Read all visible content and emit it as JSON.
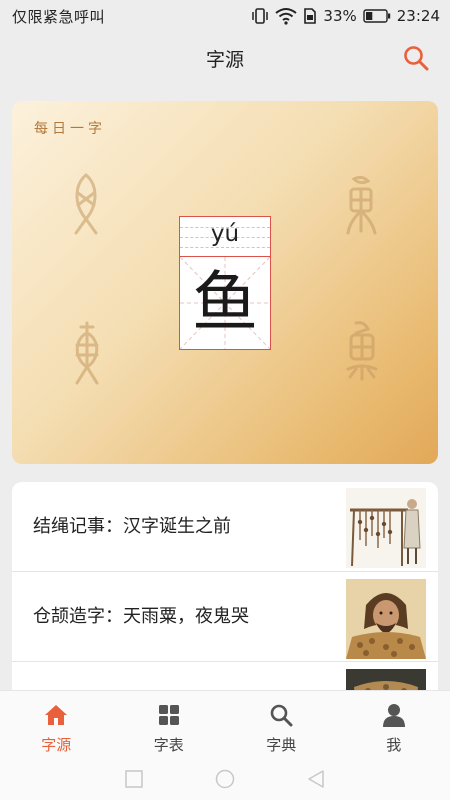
{
  "status_bar": {
    "carrier": "仅限紧急呼叫",
    "battery_percent": "33%",
    "time": "23:24",
    "battery_level": 0.33
  },
  "header": {
    "title": "字源",
    "search_icon": "search-icon"
  },
  "daily_character": {
    "label": "每日一字",
    "pinyin": "yú",
    "character": "鱼"
  },
  "articles": [
    {
      "title": "结绳记事：汉字诞生之前",
      "thumbnail": "knotted-rope-illustration"
    },
    {
      "title": "仓颉造字：天雨粟，夜鬼哭",
      "thumbnail": "cangjie-portrait"
    },
    {
      "title": "",
      "thumbnail": "bronze-artifact-photo"
    }
  ],
  "tab_bar": {
    "active": "字源",
    "tabs": [
      {
        "label": "字源",
        "icon": "home-icon"
      },
      {
        "label": "字表",
        "icon": "grid-icon"
      },
      {
        "label": "字典",
        "icon": "search-icon"
      },
      {
        "label": "我",
        "icon": "person-icon"
      }
    ]
  },
  "colors": {
    "accent": "#e8603c",
    "card_gradient_start": "#fcf1dc",
    "card_gradient_end": "#e2a859",
    "grid_red": "#d9534a"
  }
}
